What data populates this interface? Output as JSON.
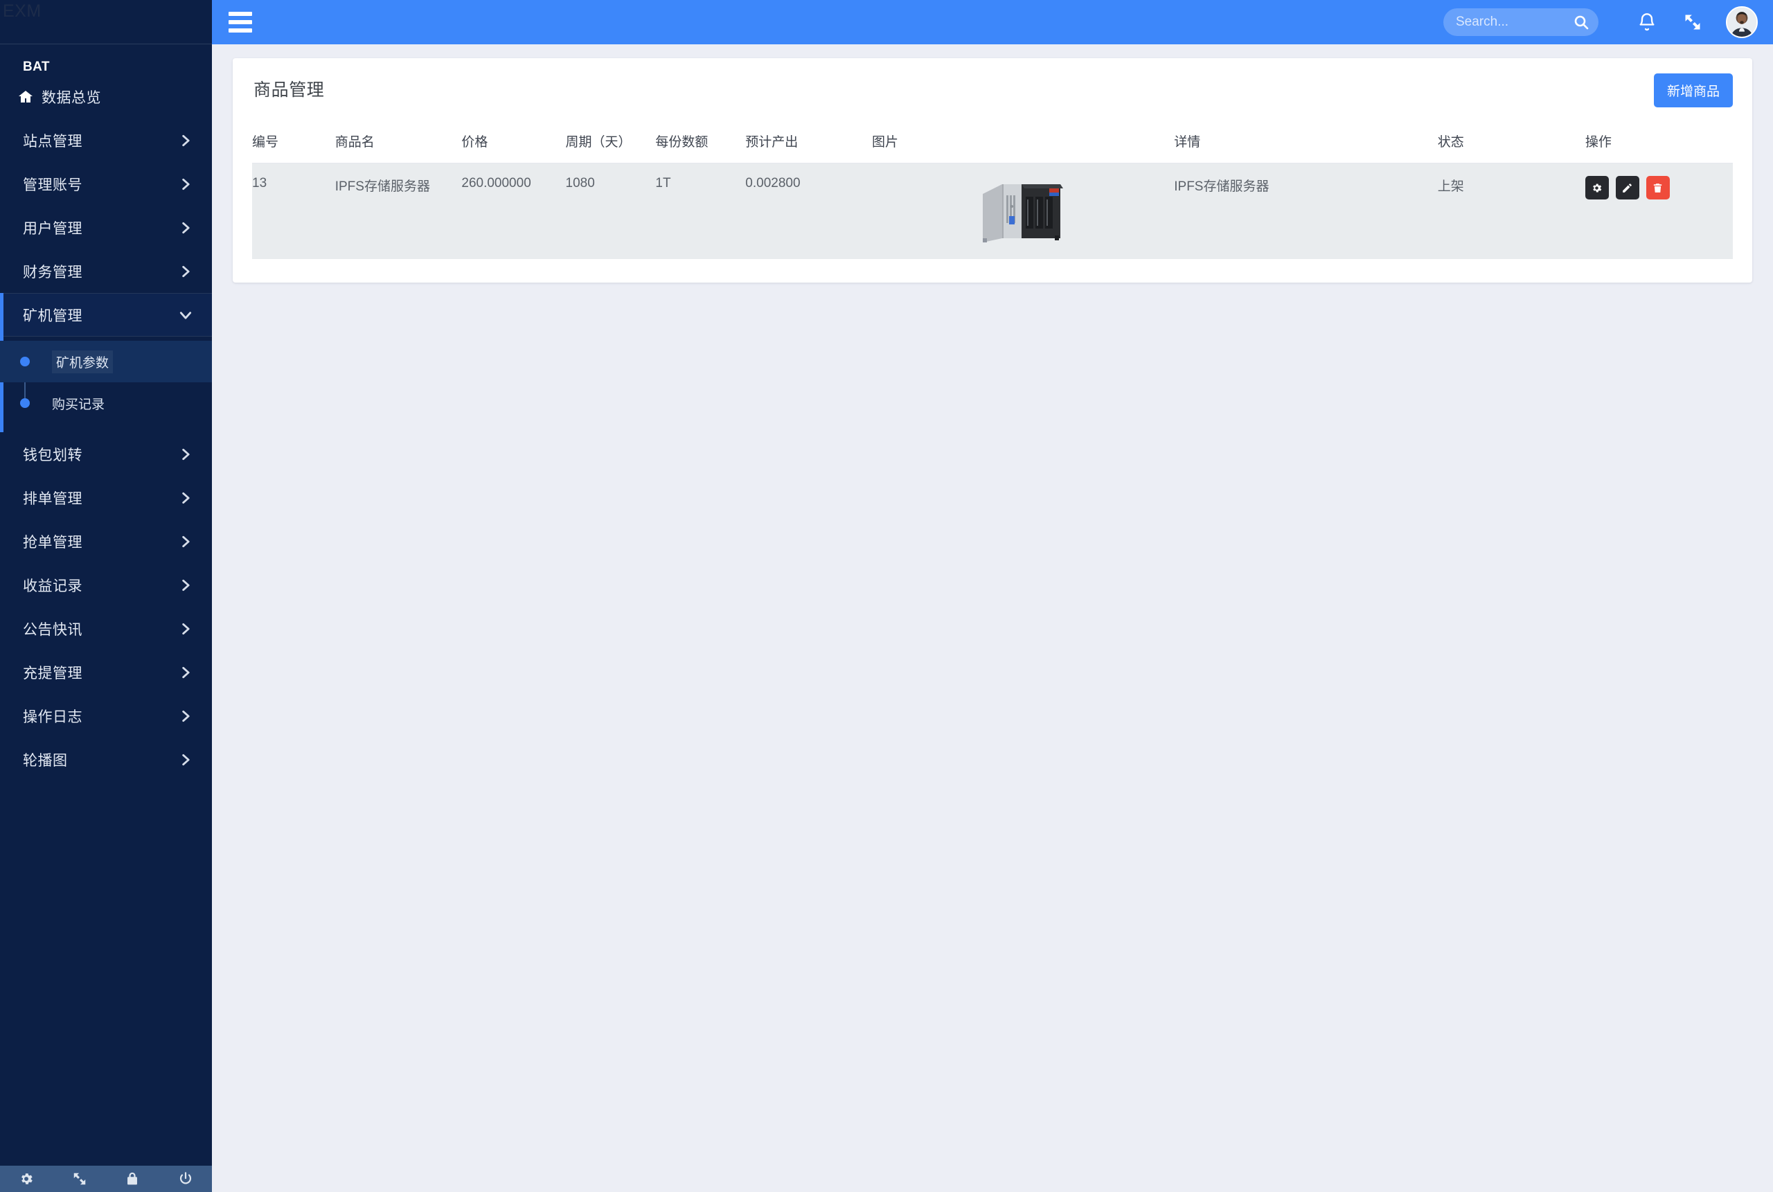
{
  "sidebar": {
    "logo": "EXM",
    "brand": "BAT",
    "items": [
      {
        "label": "数据总览",
        "icon": "home-icon",
        "type": "link"
      },
      {
        "label": "站点管理",
        "icon": "chevron-right-icon",
        "type": "group"
      },
      {
        "label": "管理账号",
        "icon": "chevron-right-icon",
        "type": "group"
      },
      {
        "label": "用户管理",
        "icon": "chevron-right-icon",
        "type": "group"
      },
      {
        "label": "财务管理",
        "icon": "chevron-right-icon",
        "type": "group"
      },
      {
        "label": "矿机管理",
        "icon": "chevron-down-icon",
        "type": "group",
        "expanded": true
      },
      {
        "label": "钱包划转",
        "icon": "chevron-right-icon",
        "type": "group"
      },
      {
        "label": "排单管理",
        "icon": "chevron-right-icon",
        "type": "group"
      },
      {
        "label": "抢单管理",
        "icon": "chevron-right-icon",
        "type": "group"
      },
      {
        "label": "收益记录",
        "icon": "chevron-right-icon",
        "type": "group"
      },
      {
        "label": "公告快讯",
        "icon": "chevron-right-icon",
        "type": "group"
      },
      {
        "label": "充提管理",
        "icon": "chevron-right-icon",
        "type": "group"
      },
      {
        "label": "操作日志",
        "icon": "chevron-right-icon",
        "type": "group"
      },
      {
        "label": "轮播图",
        "icon": "chevron-right-icon",
        "type": "group"
      }
    ],
    "submenu": [
      {
        "label": "矿机参数",
        "active": true
      },
      {
        "label": "购买记录",
        "active": false
      }
    ],
    "footer_icons": [
      "gear-icon",
      "expand-icon",
      "lock-icon",
      "power-icon"
    ]
  },
  "topbar": {
    "menu_toggle": "hamburger-icon",
    "search": {
      "value": "",
      "placeholder": "Search...",
      "icon": "search-icon"
    },
    "notification_icon": "bell-icon",
    "fullscreen_icon": "expand-icon",
    "avatar": "user-avatar"
  },
  "main": {
    "title": "商品管理",
    "add_button": "新增商品",
    "table": {
      "columns": [
        "编号",
        "商品名",
        "价格",
        "周期（天）",
        "每份数额",
        "预计产出",
        "图片",
        "详情",
        "状态",
        "操作"
      ],
      "rows": [
        {
          "id": "13",
          "name": "IPFS存储服务器",
          "price": "260.000000",
          "period": "1080",
          "quantity": "1T",
          "output": "0.002800",
          "image": "nas-server-image",
          "detail": "IPFS存储服务器",
          "status": "上架",
          "actions": [
            "settings-icon",
            "edit-icon",
            "delete-icon"
          ]
        }
      ]
    }
  },
  "colors": {
    "sidebar_bg": "#0c1f45",
    "topbar_blue": "#3d87fa",
    "accent": "#3b82f6",
    "danger": "#ef4b3b",
    "page_bg": "#eceef5",
    "row_bg": "#e9ecee"
  }
}
